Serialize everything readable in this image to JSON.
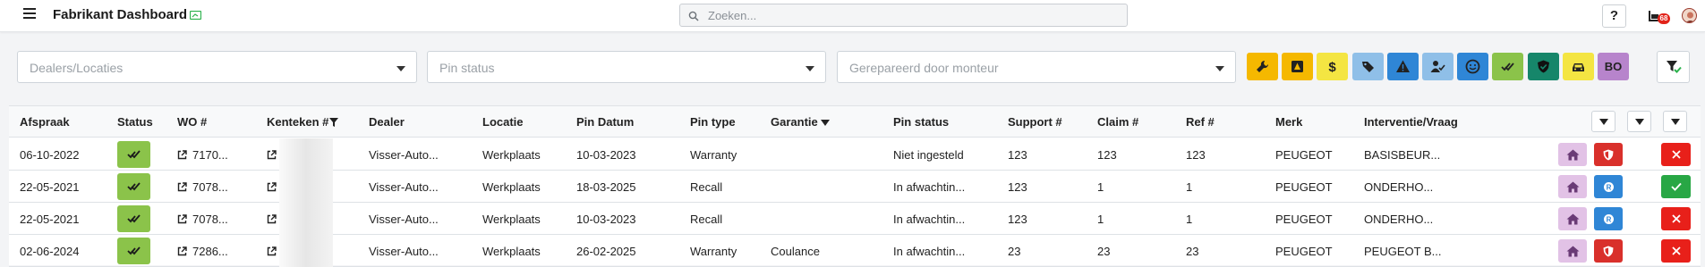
{
  "header": {
    "title": "Fabrikant Dashboard",
    "search_placeholder": "Zoeken...",
    "help_label": "?",
    "notification_count": "68"
  },
  "filters": {
    "dealers_placeholder": "Dealers/Locaties",
    "pin_status_placeholder": "Pin status",
    "repaired_by_placeholder": "Gerepareerd door monteur",
    "quick_filters": [
      {
        "icon": "wrench-icon",
        "color": "#f5b800"
      },
      {
        "icon": "road-sign-icon",
        "color": "#f5b800"
      },
      {
        "icon": "dollar-icon",
        "color": "#f4e542"
      },
      {
        "icon": "tag-icon",
        "color": "#8fbfe8"
      },
      {
        "icon": "warning-icon",
        "color": "#2f86d6"
      },
      {
        "icon": "user-check-icon",
        "color": "#8fbfe8"
      },
      {
        "icon": "face-icon",
        "color": "#2f86d6"
      },
      {
        "icon": "double-check-icon",
        "color": "#8bc34a"
      },
      {
        "icon": "shield-check-icon",
        "color": "#16866a"
      },
      {
        "icon": "car-icon",
        "color": "#f4e542"
      },
      {
        "icon": "bo-text",
        "label": "BO",
        "color": "#b784cc"
      }
    ]
  },
  "table": {
    "columns": {
      "afspraak": "Afspraak",
      "status": "Status",
      "wo": "WO #",
      "kenteken": "Kenteken #",
      "dealer": "Dealer",
      "locatie": "Locatie",
      "pin_datum": "Pin Datum",
      "pin_type": "Pin type",
      "garantie": "Garantie",
      "pin_status": "Pin status",
      "support": "Support #",
      "claim": "Claim #",
      "ref": "Ref #",
      "merk": "Merk",
      "interventie": "Interventie/Vraag"
    },
    "rows": [
      {
        "afspraak": "06-10-2022",
        "wo": "7170...",
        "dealer": "Visser-Auto...",
        "locatie": "Werkplaats",
        "pin_datum": "10-03-2023",
        "pin_type": "Warranty",
        "garantie": "",
        "pin_status": "Niet ingesteld",
        "support": "123",
        "claim": "123",
        "ref": "123",
        "merk": "PEUGEOT",
        "interventie": "BASISBEUR...",
        "shield_color": "#d9302b",
        "shield_icon": "shield-icon",
        "final_color": "#e8201a",
        "final_icon": "close-icon"
      },
      {
        "afspraak": "22-05-2021",
        "wo": "7078...",
        "dealer": "Visser-Auto...",
        "locatie": "Werkplaats",
        "pin_datum": "18-03-2025",
        "pin_type": "Recall",
        "garantie": "",
        "pin_status": "In afwachtin...",
        "support": "123",
        "claim": "1",
        "ref": "1",
        "merk": "PEUGEOT",
        "interventie": "ONDERHO...",
        "shield_color": "#2f86d6",
        "shield_icon": "recall-icon",
        "final_color": "#28a745",
        "final_icon": "check-icon"
      },
      {
        "afspraak": "22-05-2021",
        "wo": "7078...",
        "dealer": "Visser-Auto...",
        "locatie": "Werkplaats",
        "pin_datum": "10-03-2023",
        "pin_type": "Recall",
        "garantie": "",
        "pin_status": "In afwachtin...",
        "support": "123",
        "claim": "1",
        "ref": "1",
        "merk": "PEUGEOT",
        "interventie": "ONDERHO...",
        "shield_color": "#2f86d6",
        "shield_icon": "recall-icon",
        "final_color": "#e8201a",
        "final_icon": "close-icon"
      },
      {
        "afspraak": "02-06-2024",
        "wo": "7286...",
        "dealer": "Visser-Auto...",
        "locatie": "Werkplaats",
        "pin_datum": "26-02-2025",
        "pin_type": "Warranty",
        "garantie": "Coulance",
        "pin_status": "In afwachtin...",
        "support": "23",
        "claim": "23",
        "ref": "23",
        "merk": "PEUGEOT",
        "interventie": "PEUGEOT B...",
        "shield_color": "#d9302b",
        "shield_icon": "shield-icon",
        "final_color": "#e8201a",
        "final_icon": "close-icon"
      }
    ]
  }
}
